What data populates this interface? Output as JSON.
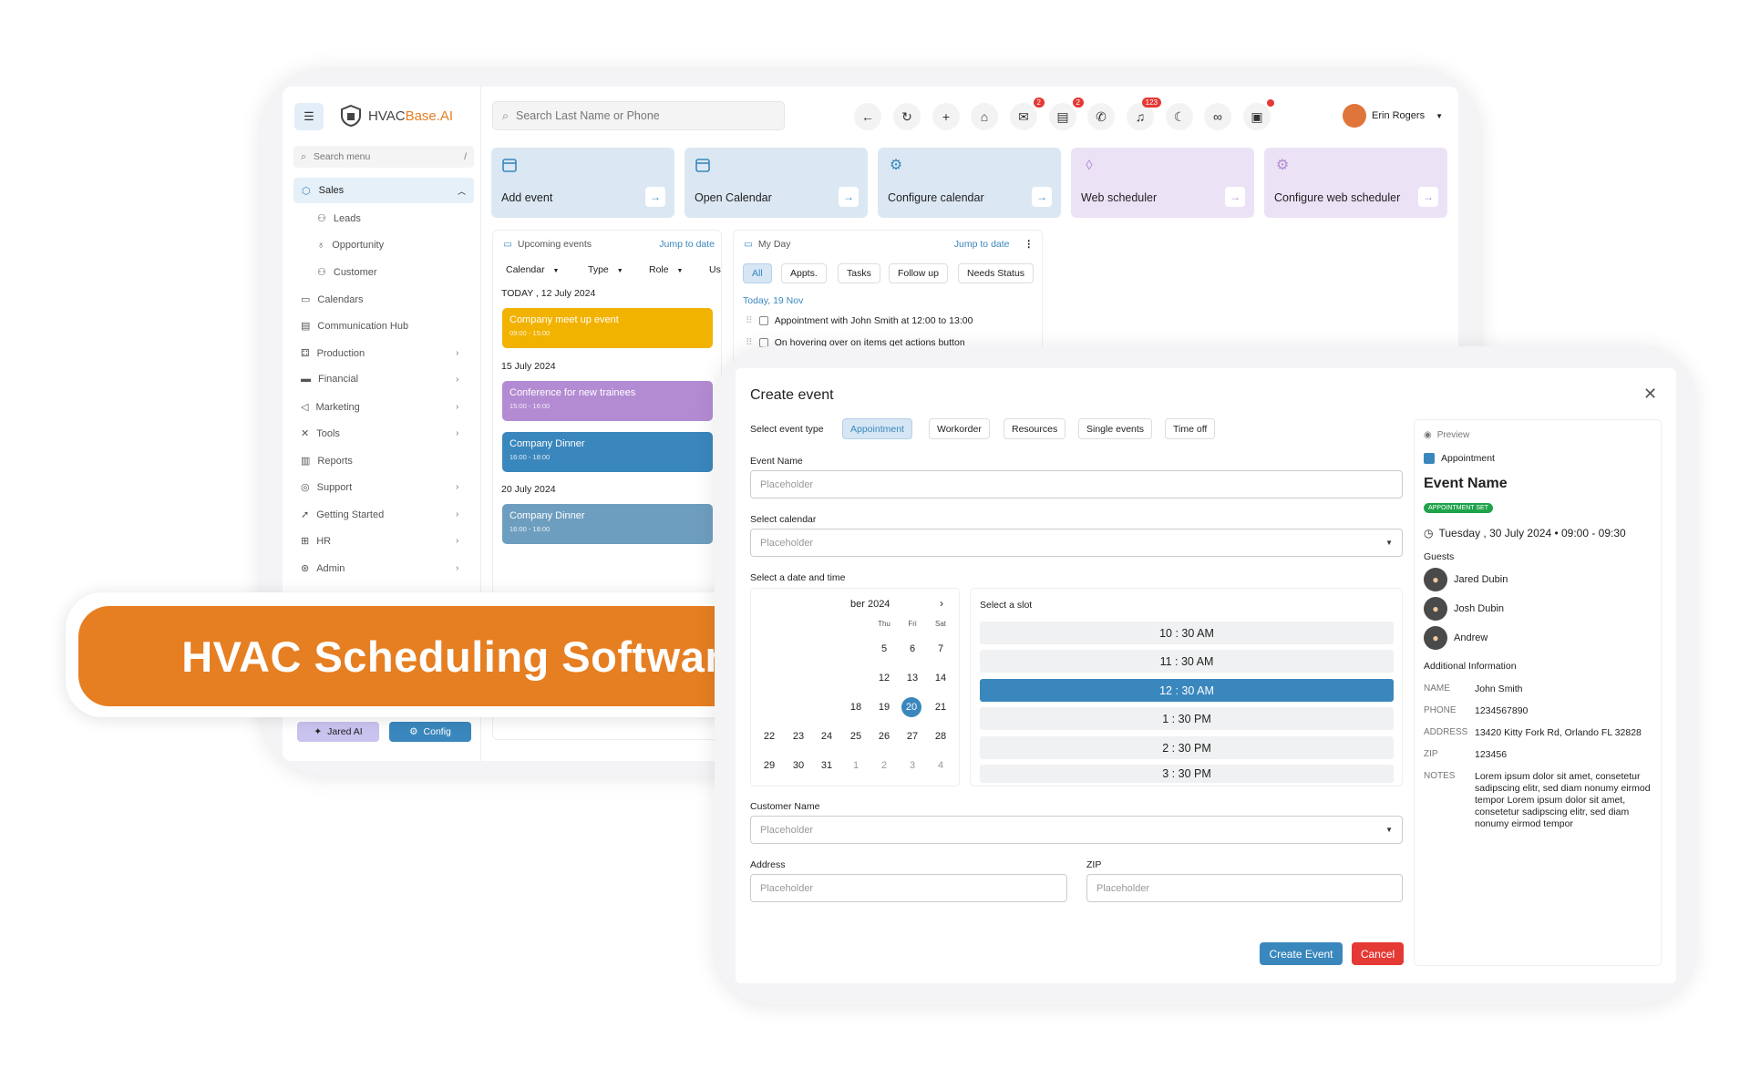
{
  "app": {
    "brand_prefix": "HVAC",
    "brand_suffix": "Base.AI",
    "search_placeholder": "Search Last Name or Phone"
  },
  "header": {
    "mail_badge": "2",
    "chat_badge": "2",
    "bell_badge": "123",
    "user_name": "Erin Rogers"
  },
  "sidebar": {
    "search_placeholder": "Search menu",
    "search_shortcut": "/",
    "sales_label": "Sales",
    "sub_items": [
      "Leads",
      "Opportunity",
      "Customer"
    ],
    "items": [
      "Calendars",
      "Communication Hub",
      "Production",
      "Financial",
      "Marketing",
      "Tools",
      "Reports",
      "Support",
      "Getting Started",
      "HR",
      "Admin"
    ],
    "jared_ai": "Jared AI",
    "config": "Config"
  },
  "cards": [
    "Add event",
    "Open Calendar",
    "Configure calendar",
    "Web scheduler",
    "Configure web scheduler"
  ],
  "upcoming": {
    "title": "Upcoming events",
    "jump": "Jump to date",
    "filters": [
      "Calendar",
      "Type",
      "Role",
      "Us"
    ],
    "groups": [
      {
        "date": "TODAY , 12 July 2024",
        "events": [
          {
            "name": "Company meet up event",
            "time": "09:00 - 15:00",
            "color": "#f2b200"
          }
        ]
      },
      {
        "date": "15 July 2024",
        "events": [
          {
            "name": "Conference for new trainees",
            "time": "15:00 - 16:00",
            "color": "#b38bd2"
          },
          {
            "name": "Company Dinner",
            "time": "16:00 - 18:00",
            "color": "#3a87bd"
          }
        ]
      },
      {
        "date": "20 July 2024",
        "events": [
          {
            "name": "Company Dinner",
            "time": "16:00 - 18:00",
            "color": "#6e9ebf"
          }
        ]
      }
    ]
  },
  "myday": {
    "title": "My Day",
    "jump": "Jump to date",
    "tabs": [
      "All",
      "Appts.",
      "Tasks",
      "Follow up",
      "Needs Status"
    ],
    "date": "Today, 19 Nov",
    "items": [
      "Appointment with John Smith at 12:00 to 13:00",
      "On hovering over on items get actions button"
    ]
  },
  "banner": {
    "text": "HVAC Scheduling Software",
    "color": "#e67e22"
  },
  "modal": {
    "title": "Create event",
    "type_label": "Select event type",
    "types": [
      "Appointment",
      "Workorder",
      "Resources",
      "Single events",
      "Time off"
    ],
    "event_name_label": "Event Name",
    "calendar_label": "Select calendar",
    "datetime_label": "Select a date and time",
    "placeholder": "Placeholder",
    "month": "ber 2024",
    "weekdays": [
      "Thu",
      "Fri",
      "Sat"
    ],
    "cal_rows": [
      [
        "5",
        "6",
        "7"
      ],
      [
        "12",
        "13",
        "14"
      ],
      [
        "18",
        "19",
        "20",
        "21"
      ],
      [
        "22",
        "23",
        "24",
        "25",
        "26",
        "27",
        "28"
      ],
      [
        "29",
        "30",
        "31",
        "1",
        "2",
        "3",
        "4"
      ]
    ],
    "selected_day": "20",
    "slot_label": "Select a slot",
    "slots": [
      "10 : 30 AM",
      "11 : 30 AM",
      "12 : 30 AM",
      "1 : 30 PM",
      "2 : 30 PM",
      "3 : 30 PM"
    ],
    "selected_slot": "12 : 30 AM",
    "customer_label": "Customer Name",
    "address_label": "Address",
    "zip_label": "ZIP",
    "create_btn": "Create Event",
    "cancel_btn": "Cancel"
  },
  "preview": {
    "label": "Preview",
    "type": "Appointment",
    "event_name": "Event Name",
    "status": "APPOINTMENT SET",
    "datetime": "Tuesday , 30 July 2024  •  09:00 - 09:30",
    "guests_label": "Guests",
    "guests": [
      "Jared Dubin",
      "Josh Dubin",
      "Andrew"
    ],
    "info_label": "Additional Information",
    "info": [
      {
        "k": "NAME",
        "v": "John Smith"
      },
      {
        "k": "PHONE",
        "v": "1234567890"
      },
      {
        "k": "ADDRESS",
        "v": "13420 Kitty Fork Rd, Orlando FL 32828"
      },
      {
        "k": "ZIP",
        "v": "123456"
      },
      {
        "k": "NOTES",
        "v": "Lorem ipsum dolor sit amet, consetetur sadipscing elitr, sed diam nonumy eirmod tempor Lorem ipsum dolor sit amet, consetetur sadipscing elitr, sed diam nonumy eirmod tempor"
      }
    ]
  }
}
